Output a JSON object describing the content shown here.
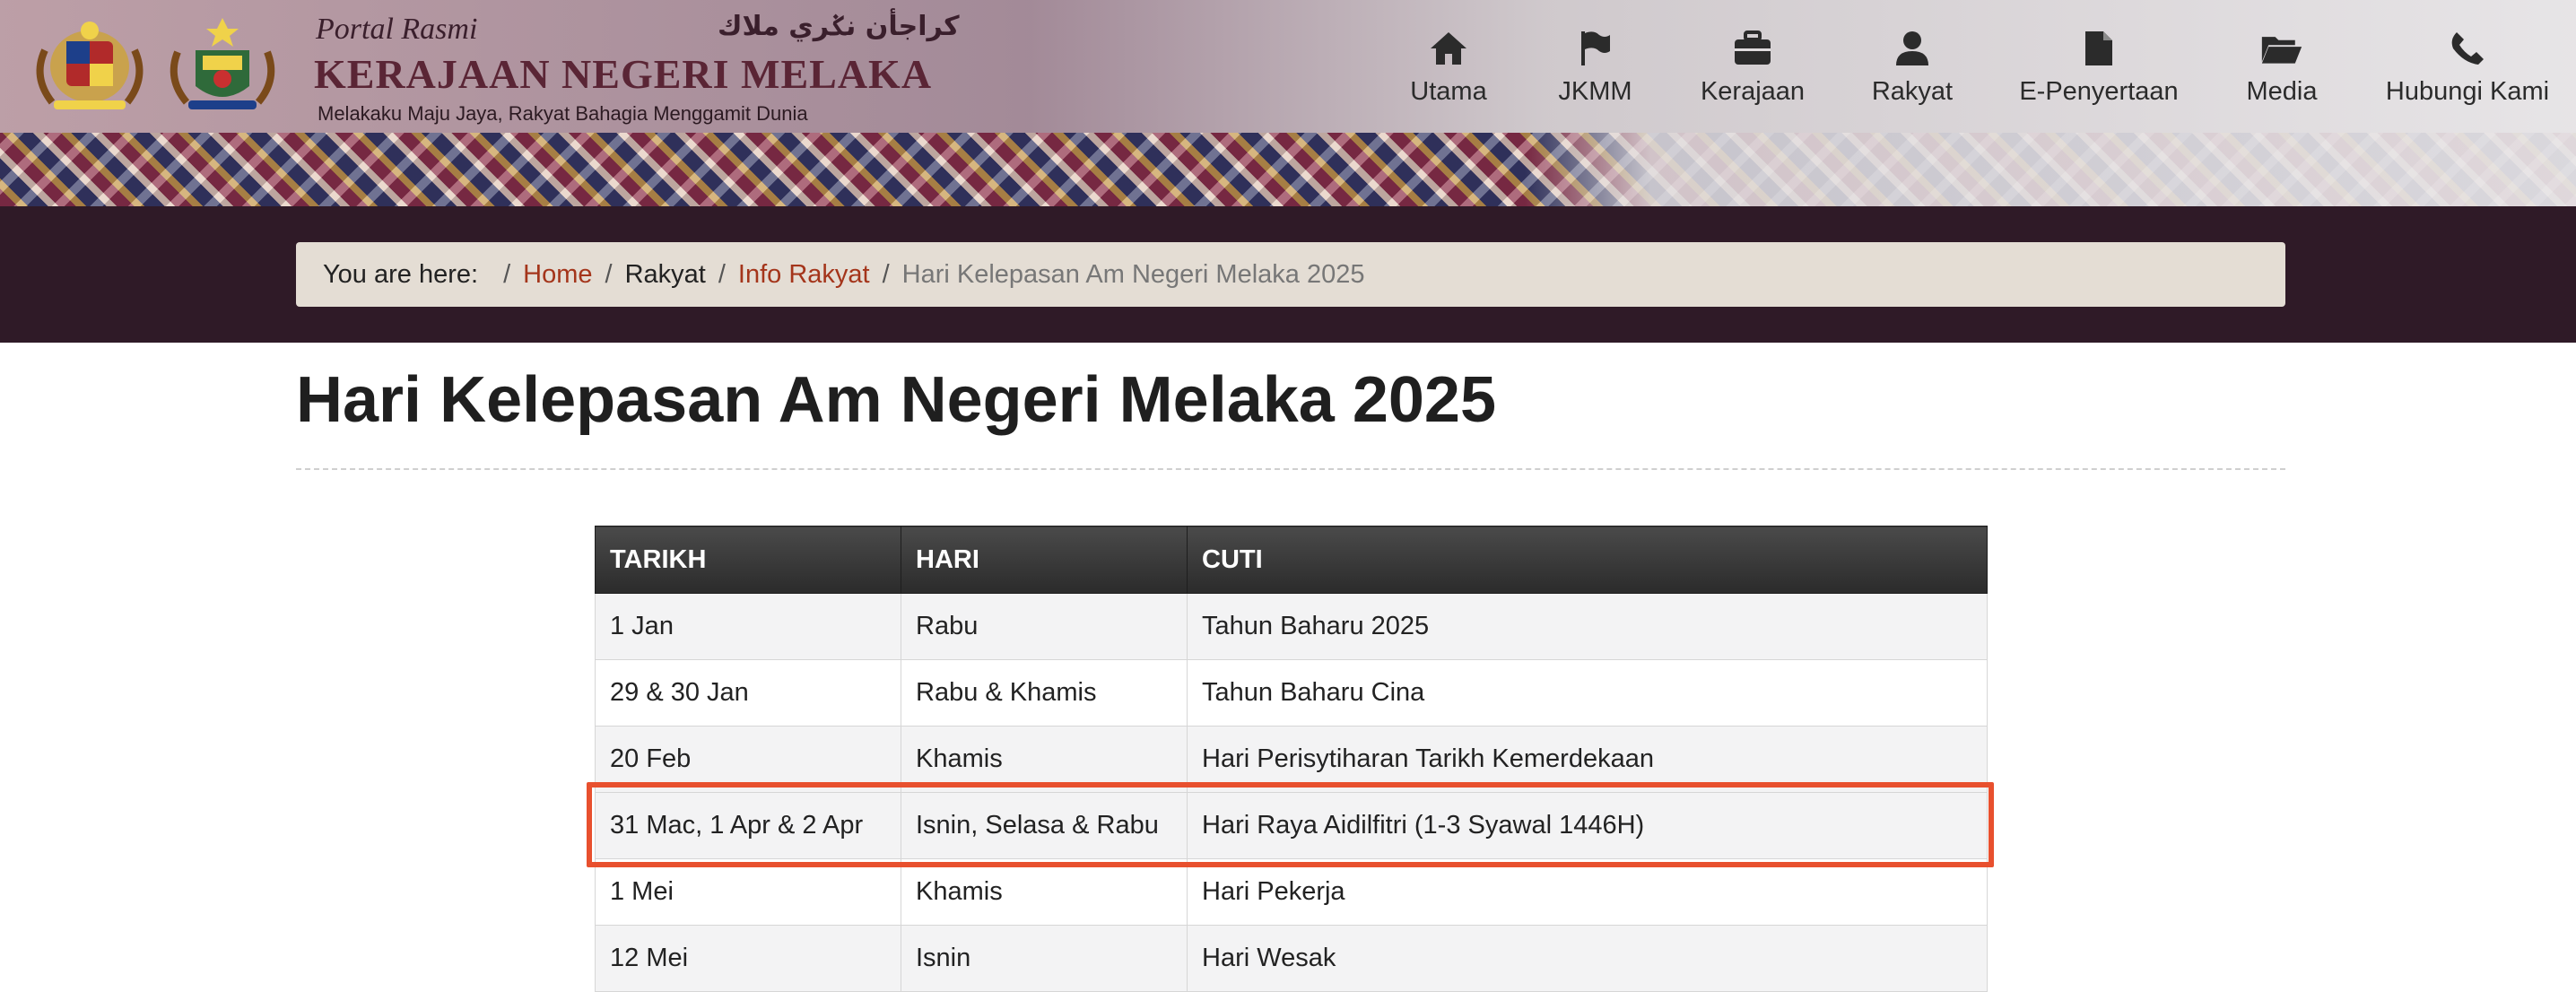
{
  "header": {
    "portal_label": "Portal Rasmi",
    "jawi_text": "كراجأن نݢري ملاك",
    "title": "KERAJAAN NEGERI MELAKA",
    "tagline": "Melakaku Maju Jaya, Rakyat Bahagia Menggamit Dunia"
  },
  "nav": [
    {
      "label": "Utama",
      "icon": "home-icon"
    },
    {
      "label": "JKMM",
      "icon": "flag-icon"
    },
    {
      "label": "Kerajaan",
      "icon": "briefcase-icon"
    },
    {
      "label": "Rakyat",
      "icon": "user-icon"
    },
    {
      "label": "E-Penyertaan",
      "icon": "document-icon"
    },
    {
      "label": "Media",
      "icon": "folder-open-icon"
    },
    {
      "label": "Hubungi Kami",
      "icon": "phone-icon"
    }
  ],
  "breadcrumb": {
    "prefix": "You are here:",
    "items": [
      "Home",
      "Rakyat",
      "Info Rakyat",
      "Hari Kelepasan Am Negeri Melaka 2025"
    ]
  },
  "page_title": "Hari Kelepasan Am Negeri Melaka 2025",
  "table": {
    "headers": [
      "TARIKH",
      "HARI",
      "CUTI"
    ],
    "rows": [
      [
        "1 Jan",
        "Rabu",
        "Tahun Baharu 2025"
      ],
      [
        "29 & 30 Jan",
        "Rabu & Khamis",
        "Tahun Baharu Cina"
      ],
      [
        "20 Feb",
        "Khamis",
        "Hari Perisytiharan Tarikh Kemerdekaan"
      ],
      [
        "31 Mac, 1 Apr & 2 Apr",
        "Isnin, Selasa & Rabu",
        "Hari Raya Aidilfitri (1-3 Syawal 1446H)"
      ],
      [
        "1 Mei",
        "Khamis",
        "Hari Pekerja"
      ],
      [
        "12 Mei",
        "Isnin",
        "Hari Wesak"
      ]
    ]
  },
  "colors": {
    "breadcrumb_band": "#2f1a27",
    "link": "#a4351b",
    "highlight": "#e8502e"
  }
}
